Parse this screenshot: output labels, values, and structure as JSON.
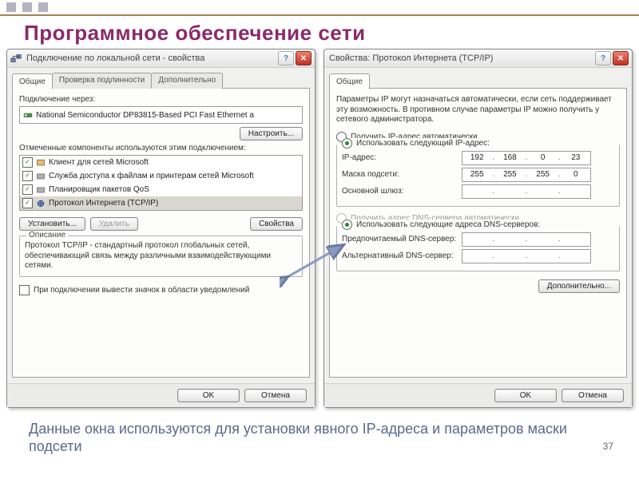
{
  "slide": {
    "title": "Программное обеспечение сети",
    "caption": "Данные окна используются для установки явного IP-адреса и параметров маски подсети",
    "page_number": "37"
  },
  "dlg_left": {
    "title": "Подключение по локальной сети - свойства",
    "tabs": {
      "general": "Общие",
      "auth": "Проверка подлинности",
      "adv": "Дополнительно"
    },
    "connect_via_label": "Подключение через:",
    "adapter": "National Semiconductor DP83815-Based PCI Fast Ethernet a",
    "configure": "Настроить...",
    "components_label": "Отмеченные компоненты используются этим подключением:",
    "components": [
      "Клиент для сетей Microsoft",
      "Служба доступа к файлам и принтерам сетей Microsoft",
      "Планировщик пакетов QoS",
      "Протокол Интернета (TCP/IP)"
    ],
    "install": "Установить...",
    "remove": "Удалить",
    "properties": "Свойства",
    "desc_legend": "Описание",
    "desc_text": "Протокол TCP/IP - стандартный протокол глобальных сетей, обеспечивающий связь между различными взаимодействующими сетями.",
    "tray_checkbox": "При подключении вывести значок в области уведомлений",
    "ok": "OK",
    "cancel": "Отмена"
  },
  "dlg_right": {
    "title": "Свойства: Протокол Интернета (TCP/IP)",
    "tab_general": "Общие",
    "intro": "Параметры IP могут назначаться автоматически, если сеть поддерживает эту возможность. В противном случае параметры IP можно получить у сетевого администратора.",
    "radio_auto_ip": "Получить IP-адрес автоматически",
    "radio_manual_ip": "Использовать следующий IP-адрес:",
    "ip_label": "IP-адрес:",
    "ip": {
      "a": "192",
      "b": "168",
      "c": "0",
      "d": "23"
    },
    "mask_label": "Маска подсети:",
    "mask": {
      "a": "255",
      "b": "255",
      "c": "255",
      "d": "0"
    },
    "gateway_label": "Основной шлюз:",
    "radio_auto_dns": "Получить адрес DNS-сервера автоматически",
    "radio_manual_dns": "Использовать следующие адреса DNS-серверов:",
    "pref_dns": "Предпочитаемый DNS-сервер:",
    "alt_dns": "Альтернативный DNS-сервер:",
    "advanced": "Дополнительно...",
    "ok": "OK",
    "cancel": "Отмена"
  }
}
